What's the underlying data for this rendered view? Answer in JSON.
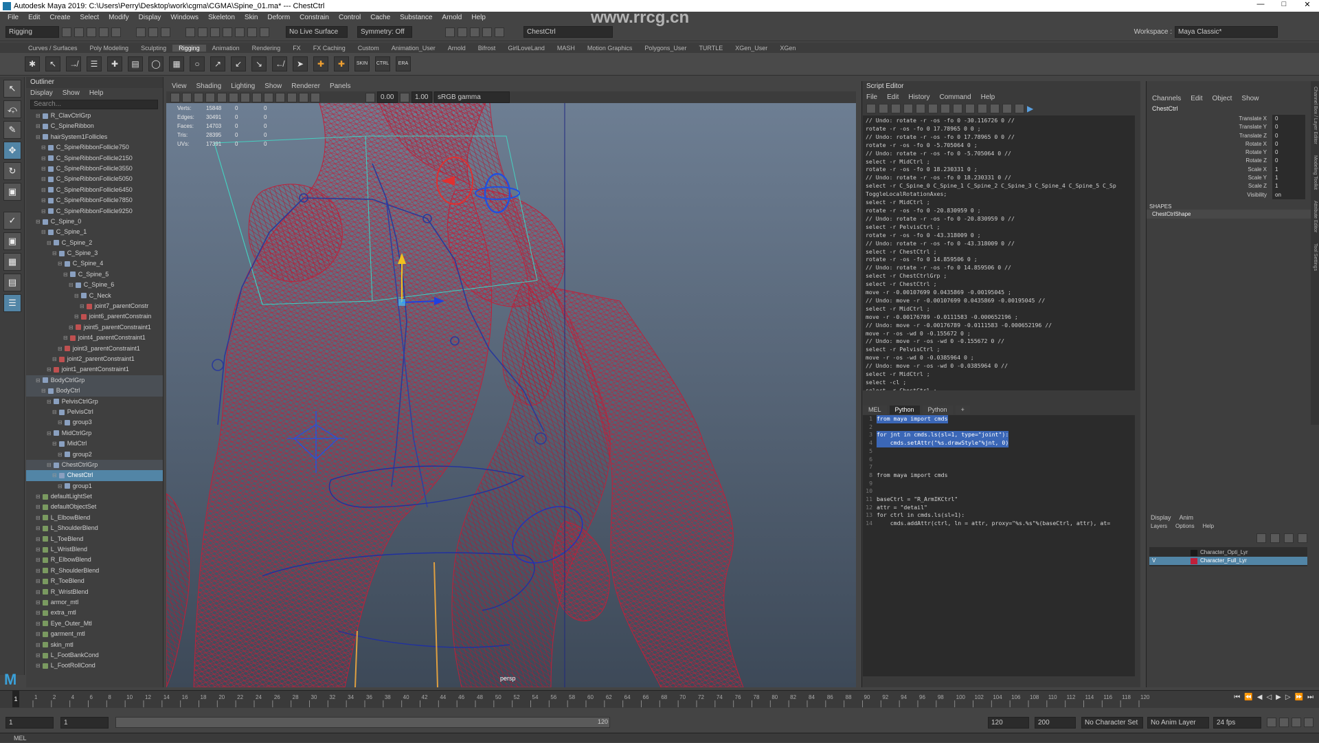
{
  "titlebar": {
    "app_title": "Autodesk Maya 2019: C:\\Users\\Perry\\Desktop\\work\\cgma\\CGMA\\Spine_01.ma*  ---  ChestCtrl",
    "watermark": "www.rrcg.cn"
  },
  "menus": [
    "File",
    "Edit",
    "Create",
    "Select",
    "Modify",
    "Display",
    "Windows",
    "Skeleton",
    "Skin",
    "Deform",
    "Constrain",
    "Control",
    "Cache",
    "Substance",
    "Arnold",
    "Help"
  ],
  "statusline": {
    "mode": "Rigging",
    "live_surface": "No Live Surface",
    "symmetry": "Symmetry: Off",
    "object_field": "ChestCtrl",
    "workspace_label": "Workspace :",
    "workspace": "Maya Classic*"
  },
  "shelf_tabs": [
    "Curves / Surfaces",
    "Poly Modeling",
    "Sculpting",
    "Rigging",
    "Animation",
    "Rendering",
    "FX",
    "FX Caching",
    "Custom",
    "Animation_User",
    "Arnold",
    "Bifrost",
    "GirlLoveLand",
    "MASH",
    "Motion Graphics",
    "Polygons_User",
    "TURTLE",
    "XGen_User",
    "XGen"
  ],
  "shelf_active": "Rigging",
  "shelf_icon_labels": [
    "SKIN",
    "CTRL",
    "ERA"
  ],
  "outliner": {
    "title": "Outliner",
    "menus": [
      "Display",
      "Show",
      "Help"
    ],
    "search_placeholder": "Search...",
    "items": [
      {
        "label": "R_ClavCtrlGrp",
        "depth": 1,
        "state": ""
      },
      {
        "label": "C_SpineRibbon",
        "depth": 1,
        "state": ""
      },
      {
        "label": "hairSystem1Follicles",
        "depth": 1,
        "state": ""
      },
      {
        "label": "C_SpineRibbonFollicle750",
        "depth": 2,
        "state": ""
      },
      {
        "label": "C_SpineRibbonFollicle2150",
        "depth": 2,
        "state": ""
      },
      {
        "label": "C_SpineRibbonFollicle3550",
        "depth": 2,
        "state": ""
      },
      {
        "label": "C_SpineRibbonFollicle5050",
        "depth": 2,
        "state": ""
      },
      {
        "label": "C_SpineRibbonFollicle6450",
        "depth": 2,
        "state": ""
      },
      {
        "label": "C_SpineRibbonFollicle7850",
        "depth": 2,
        "state": ""
      },
      {
        "label": "C_SpineRibbonFollicle9250",
        "depth": 2,
        "state": ""
      },
      {
        "label": "C_Spine_0",
        "depth": 1,
        "state": ""
      },
      {
        "label": "C_Spine_1",
        "depth": 2,
        "state": ""
      },
      {
        "label": "C_Spine_2",
        "depth": 3,
        "state": ""
      },
      {
        "label": "C_Spine_3",
        "depth": 4,
        "state": ""
      },
      {
        "label": "C_Spine_4",
        "depth": 5,
        "state": ""
      },
      {
        "label": "C_Spine_5",
        "depth": 6,
        "state": ""
      },
      {
        "label": "C_Spine_6",
        "depth": 7,
        "state": ""
      },
      {
        "label": "C_Neck",
        "depth": 8,
        "state": ""
      },
      {
        "label": "joint7_parentConstr",
        "depth": 9,
        "state": ""
      },
      {
        "label": "joint6_parentConstrain",
        "depth": 8,
        "state": ""
      },
      {
        "label": "joint5_parentConstraint1",
        "depth": 7,
        "state": ""
      },
      {
        "label": "joint4_parentConstraint1",
        "depth": 6,
        "state": ""
      },
      {
        "label": "joint3_parentConstraint1",
        "depth": 5,
        "state": ""
      },
      {
        "label": "joint2_parentConstraint1",
        "depth": 4,
        "state": ""
      },
      {
        "label": "joint1_parentConstraint1",
        "depth": 3,
        "state": ""
      },
      {
        "label": "BodyCtrlGrp",
        "depth": 1,
        "state": "grp"
      },
      {
        "label": "BodyCtrl",
        "depth": 2,
        "state": "grp"
      },
      {
        "label": "PelvisCtrlGrp",
        "depth": 3,
        "state": ""
      },
      {
        "label": "PelvisCtrl",
        "depth": 4,
        "state": ""
      },
      {
        "label": "group3",
        "depth": 5,
        "state": ""
      },
      {
        "label": "MidCtrlGrp",
        "depth": 3,
        "state": ""
      },
      {
        "label": "MidCtrl",
        "depth": 4,
        "state": ""
      },
      {
        "label": "group2",
        "depth": 5,
        "state": ""
      },
      {
        "label": "ChestCtrlGrp",
        "depth": 3,
        "state": "grp"
      },
      {
        "label": "ChestCtrl",
        "depth": 4,
        "state": "sel"
      },
      {
        "label": "group1",
        "depth": 5,
        "state": ""
      },
      {
        "label": "defaultLightSet",
        "depth": 1,
        "state": ""
      },
      {
        "label": "defaultObjectSet",
        "depth": 1,
        "state": ""
      },
      {
        "label": "L_ElbowBlend",
        "depth": 1,
        "state": ""
      },
      {
        "label": "L_ShoulderBlend",
        "depth": 1,
        "state": ""
      },
      {
        "label": "L_ToeBlend",
        "depth": 1,
        "state": ""
      },
      {
        "label": "L_WristBlend",
        "depth": 1,
        "state": ""
      },
      {
        "label": "R_ElbowBlend",
        "depth": 1,
        "state": ""
      },
      {
        "label": "R_ShoulderBlend",
        "depth": 1,
        "state": ""
      },
      {
        "label": "R_ToeBlend",
        "depth": 1,
        "state": ""
      },
      {
        "label": "R_WristBlend",
        "depth": 1,
        "state": ""
      },
      {
        "label": "armor_mtl",
        "depth": 1,
        "state": ""
      },
      {
        "label": "extra_mtl",
        "depth": 1,
        "state": ""
      },
      {
        "label": "Eye_Outer_Mtl",
        "depth": 1,
        "state": ""
      },
      {
        "label": "garment_mtl",
        "depth": 1,
        "state": ""
      },
      {
        "label": "skin_mtl",
        "depth": 1,
        "state": ""
      },
      {
        "label": "L_FootBankCond",
        "depth": 1,
        "state": ""
      },
      {
        "label": "L_FootRollCond",
        "depth": 1,
        "state": ""
      }
    ]
  },
  "viewport": {
    "menus": [
      "View",
      "Shading",
      "Lighting",
      "Show",
      "Renderer",
      "Panels"
    ],
    "field_a": "0.00",
    "field_b": "1.00",
    "colorspace": "sRGB gamma",
    "camera": "persp",
    "hud": [
      {
        "label": "Verts:",
        "v1": "15848",
        "v2": "0",
        "v3": "0"
      },
      {
        "label": "Edges:",
        "v1": "30491",
        "v2": "0",
        "v3": "0"
      },
      {
        "label": "Faces:",
        "v1": "14703",
        "v2": "0",
        "v3": "0"
      },
      {
        "label": "Tris:",
        "v1": "28395",
        "v2": "0",
        "v3": "0"
      },
      {
        "label": "UVs:",
        "v1": "17391",
        "v2": "0",
        "v3": "0"
      }
    ]
  },
  "script_editor": {
    "title": "Script Editor",
    "menus": [
      "File",
      "Edit",
      "History",
      "Command",
      "Help"
    ],
    "history": [
      "// Undo: rotate -r -os -fo 0 -30.116726 0 //",
      "rotate -r -os -fo 0 17.78965 0 0 ;",
      "// Undo: rotate -r -os -fo 0 17.78965 0 0 //",
      "rotate -r -os -fo 0 -5.705064 0 ;",
      "// Undo: rotate -r -os -fo 0 -5.705064 0 //",
      "select -r MidCtrl ;",
      "rotate -r -os -fo 0 18.230331 0 ;",
      "// Undo: rotate -r -os -fo 0 18.230331 0 //",
      "select -r C_Spine_0 C_Spine_1 C_Spine_2 C_Spine_3 C_Spine_4 C_Spine_5 C_Sp",
      "ToggleLocalRotationAxes;",
      "select -r MidCtrl ;",
      "rotate -r -os -fo 0 -20.830959 0 ;",
      "// Undo: rotate -r -os -fo 0 -20.830959 0 //",
      "select -r PelvisCtrl ;",
      "rotate -r -os -fo 0 -43.318009 0 ;",
      "// Undo: rotate -r -os -fo 0 -43.318009 0 //",
      "select -r ChestCtrl ;",
      "rotate -r -os -fo 0 14.859506 0 ;",
      "// Undo: rotate -r -os -fo 0 14.859506 0 //",
      "select -r ChestCtrlGrp ;",
      "select -r ChestCtrl ;",
      "move -r -0.00107699 0.0435869 -0.00195045 ;",
      "// Undo: move -r -0.00107699 0.0435869 -0.00195045 //",
      "select -r MidCtrl ;",
      "move -r -0.00176789 -0.0111583 -0.000652196 ;",
      "// Undo: move -r -0.00176789 -0.0111583 -0.000652196 //",
      "move -r -os -wd 0 -0.155672 0 ;",
      "// Undo: move -r -os -wd 0 -0.155672 0 //",
      "select -r PelvisCtrl ;",
      "move -r -os -wd 0 -0.0385964 0 ;",
      "// Undo: move -r -os -wd 0 -0.0385964 0 //",
      "select -r MidCtrl ;",
      "select -cl  ;",
      "select -r ChestCtrl ;"
    ],
    "tabs": [
      "MEL",
      "Python",
      "Python",
      "+"
    ],
    "active_tab": "Python",
    "code": [
      "from maya import cmds",
      "",
      "for jnt in cmds.ls(sl=1, type=\"joint\"):",
      "    cmds.setAttr(\"%s.drawStyle\"%jnt, 0)",
      "",
      "",
      "",
      "from maya import cmds",
      "",
      "",
      "baseCtrl = \"R_ArmIKCtrl\"",
      "attr = \"detail\"",
      "for ctrl in cmds.ls(sl=1):",
      "    cmds.addAttr(ctrl, ln = attr, proxy=\"%s.%s\"%(baseCtrl, attr), at="
    ]
  },
  "channel_box": {
    "menus": [
      "Channels",
      "Edit",
      "Object",
      "Show"
    ],
    "object": "ChestCtrl",
    "attributes": [
      {
        "name": "Translate X",
        "value": "0"
      },
      {
        "name": "Translate Y",
        "value": "0"
      },
      {
        "name": "Translate Z",
        "value": "0"
      },
      {
        "name": "Rotate X",
        "value": "0"
      },
      {
        "name": "Rotate Y",
        "value": "0"
      },
      {
        "name": "Rotate Z",
        "value": "0"
      },
      {
        "name": "Scale X",
        "value": "1"
      },
      {
        "name": "Scale Y",
        "value": "1"
      },
      {
        "name": "Scale Z",
        "value": "1"
      },
      {
        "name": "Visibility",
        "value": "on"
      }
    ],
    "shapes_header": "SHAPES",
    "shape_name": "ChestCtrlShape",
    "layer_tabs": [
      "Display",
      "Anim"
    ],
    "layer_menus": [
      "Layers",
      "Options",
      "Help"
    ],
    "layers": [
      {
        "name": "Character_Opti_Lyr",
        "color": "#1a1a1a",
        "vis": "",
        "sel": false
      },
      {
        "name": "Character_Full_Lyr",
        "color": "#c0203a",
        "vis": "V",
        "sel": true
      }
    ],
    "side_tabs": [
      "Channel Box / Layer Editor",
      "Modeling Toolkit",
      "Attribute Editor",
      "Tool Settings"
    ]
  },
  "time_slider": {
    "ticks": [
      "1",
      "2",
      "4",
      "6",
      "8",
      "10",
      "12",
      "14",
      "16",
      "18",
      "20",
      "22",
      "24",
      "26",
      "28",
      "30",
      "32",
      "34",
      "36",
      "38",
      "40",
      "42",
      "44",
      "46",
      "48",
      "50",
      "52",
      "54",
      "56",
      "58",
      "60",
      "62",
      "64",
      "66",
      "68",
      "70",
      "72",
      "74",
      "76",
      "78",
      "80",
      "82",
      "84",
      "86",
      "88",
      "90",
      "92",
      "94",
      "96",
      "98",
      "100",
      "102",
      "104",
      "106",
      "108",
      "110",
      "112",
      "114",
      "116",
      "118",
      "120"
    ],
    "current_frame": "1",
    "start": "1",
    "playback_start": "1",
    "range_label": "120",
    "end": "120",
    "anim_end": "200",
    "char_set": "No Character Set",
    "anim_layer": "No Anim Layer",
    "fps": "24 fps"
  },
  "command_line": {
    "label": "MEL"
  },
  "colors": {
    "accent": "#5285a6",
    "wire": "#c0203a",
    "selection": "#3b67b7"
  }
}
